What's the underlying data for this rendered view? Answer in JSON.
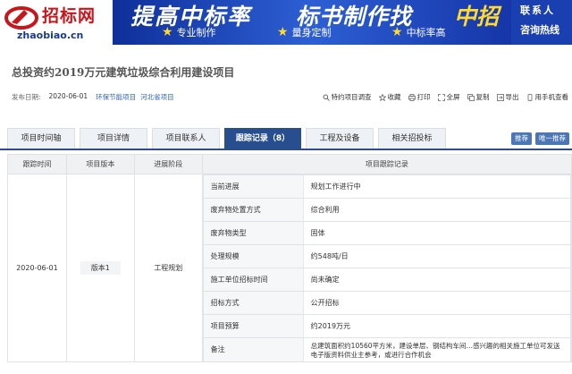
{
  "banner": {
    "logo_cn": "招标网",
    "logo_en": "zhaobiao.cn",
    "slogan_part1": "提高中标率",
    "slogan_part2": "标书制作找",
    "slogan_highlight": "中招",
    "features": [
      "专业制作",
      "量身定制",
      "中标率高"
    ],
    "contact_line1": "联系人",
    "contact_line2": "咨询热线"
  },
  "project": {
    "title": "总投资约2019万元建筑垃圾综合利用建设项目",
    "publish_label": "发布日期:",
    "publish_date": "2020-06-01",
    "category": "环保节能项目",
    "region": "河北省项目"
  },
  "actions": [
    "特约项目调查",
    "收藏",
    "打印",
    "全屏",
    "复制",
    "导出",
    "用手机查看"
  ],
  "tabs": [
    "项目时间轴",
    "项目详情",
    "项目联系人",
    "跟踪记录（8）",
    "工程及设备",
    "相关招投标"
  ],
  "active_tab": 3,
  "right_buttons": [
    "推荐",
    "唯一推荐"
  ],
  "table": {
    "headers": [
      "跟踪时间",
      "项目版本",
      "进展阶段",
      "项目跟踪记录"
    ],
    "row": {
      "time": "2020-06-01",
      "version": "版本1",
      "stage": "工程规划",
      "details": [
        {
          "key": "当前进展",
          "value": "规划工作进行中"
        },
        {
          "key": "废弃物处置方式",
          "value": "综合利用"
        },
        {
          "key": "废弃物类型",
          "value": "固体"
        },
        {
          "key": "处理规模",
          "value": "约548吨/日"
        },
        {
          "key": "施工单位招标时间",
          "value": "尚未确定"
        },
        {
          "key": "招标方式",
          "value": "公开招标"
        },
        {
          "key": "项目预算",
          "value": "约2019万元"
        },
        {
          "key": "备注",
          "value": "总建筑面积约10560平方米，建设单层、钢结构车间…感兴趣的相关施工单位可发送电子版资料供业主参考，或进行合作机会"
        }
      ]
    }
  },
  "colors": {
    "brand_red": "#c8161d",
    "tab_active": "#284e8f",
    "link": "#2e64b9",
    "ad_blue": "#1a3fb0",
    "highlight_yellow": "#ffd92e"
  }
}
